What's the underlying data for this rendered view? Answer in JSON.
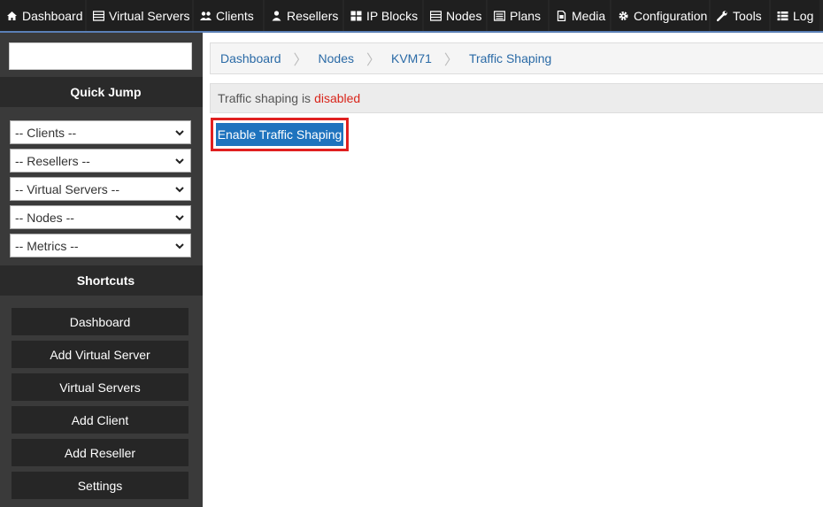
{
  "nav": {
    "tabs": [
      {
        "label": "Dashboard",
        "icon": "home-icon"
      },
      {
        "label": "Virtual Servers",
        "icon": "server-icon"
      },
      {
        "label": "Clients",
        "icon": "users-icon"
      },
      {
        "label": "Resellers",
        "icon": "user-icon"
      },
      {
        "label": "IP Blocks",
        "icon": "grid-icon"
      },
      {
        "label": "Nodes",
        "icon": "server-icon"
      },
      {
        "label": "Plans",
        "icon": "list-icon"
      },
      {
        "label": "Media",
        "icon": "file-icon"
      },
      {
        "label": "Configuration",
        "icon": "gear-icon"
      },
      {
        "label": "Tools",
        "icon": "wrench-icon"
      },
      {
        "label": "Log",
        "icon": "list-icon"
      }
    ]
  },
  "sidebar": {
    "search_value": "",
    "quick_jump_title": "Quick Jump",
    "quick_jump": [
      "-- Clients --",
      "-- Resellers --",
      "-- Virtual Servers --",
      "-- Nodes --",
      "-- Metrics --"
    ],
    "shortcuts_title": "Shortcuts",
    "shortcuts": [
      "Dashboard",
      "Add Virtual Server",
      "Virtual Servers",
      "Add Client",
      "Add Reseller",
      "Settings"
    ]
  },
  "breadcrumb": [
    "Dashboard",
    "Nodes",
    "KVM71",
    "Traffic Shaping"
  ],
  "alert": {
    "text": "Traffic shaping is",
    "status": "disabled",
    "status_color": "#d9261c"
  },
  "action": {
    "label": "Enable Traffic Shaping",
    "color": "#1e73be",
    "highlight_color": "#e02020"
  }
}
